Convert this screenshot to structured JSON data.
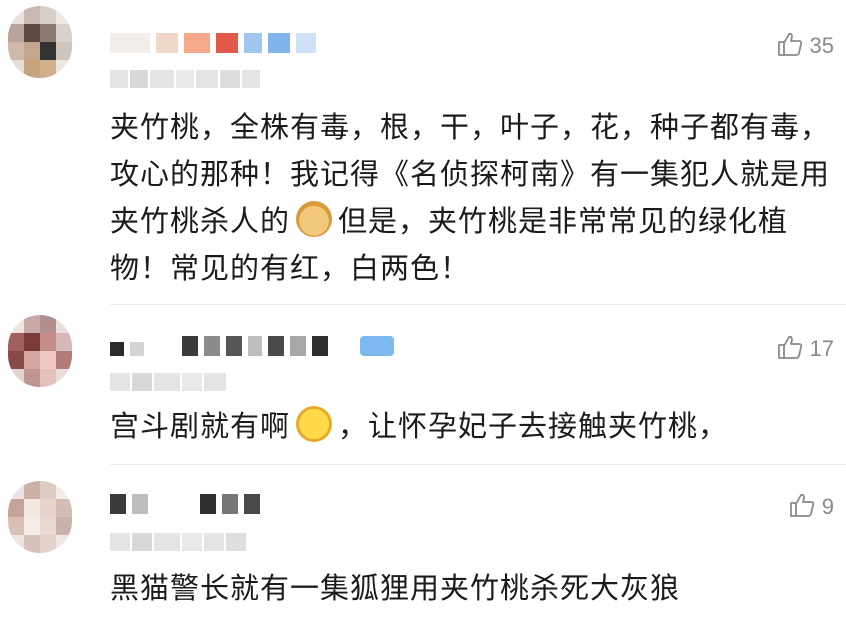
{
  "comments": [
    {
      "likes": "35",
      "text_before_emoji": "夹竹桃，全株有毒，根，干，叶子，花，种子都有毒，攻心的那种！我记得《名侦探柯南》有一集犯人就是用夹竹桃杀人的",
      "emoji": "doge-emoji",
      "text_after_emoji": "但是，夹竹桃是非常常见的绿化植物！常见的有红，白两色！"
    },
    {
      "likes": "17",
      "text_before_emoji": "宫斗剧就有啊",
      "emoji": "laugh-cry-emoji",
      "text_after_emoji": "，让怀孕妃子去接触夹竹桃，"
    },
    {
      "likes": "9",
      "text_before_emoji": "黑猫警长就有一集狐狸用夹竹桃杀死大灰狼",
      "emoji": "",
      "text_after_emoji": ""
    }
  ],
  "icons": {
    "like": "thumbs-up-icon"
  },
  "colors": {
    "text": "#1b1b1b",
    "meta": "#8a8a8a",
    "divider": "#ececec"
  }
}
